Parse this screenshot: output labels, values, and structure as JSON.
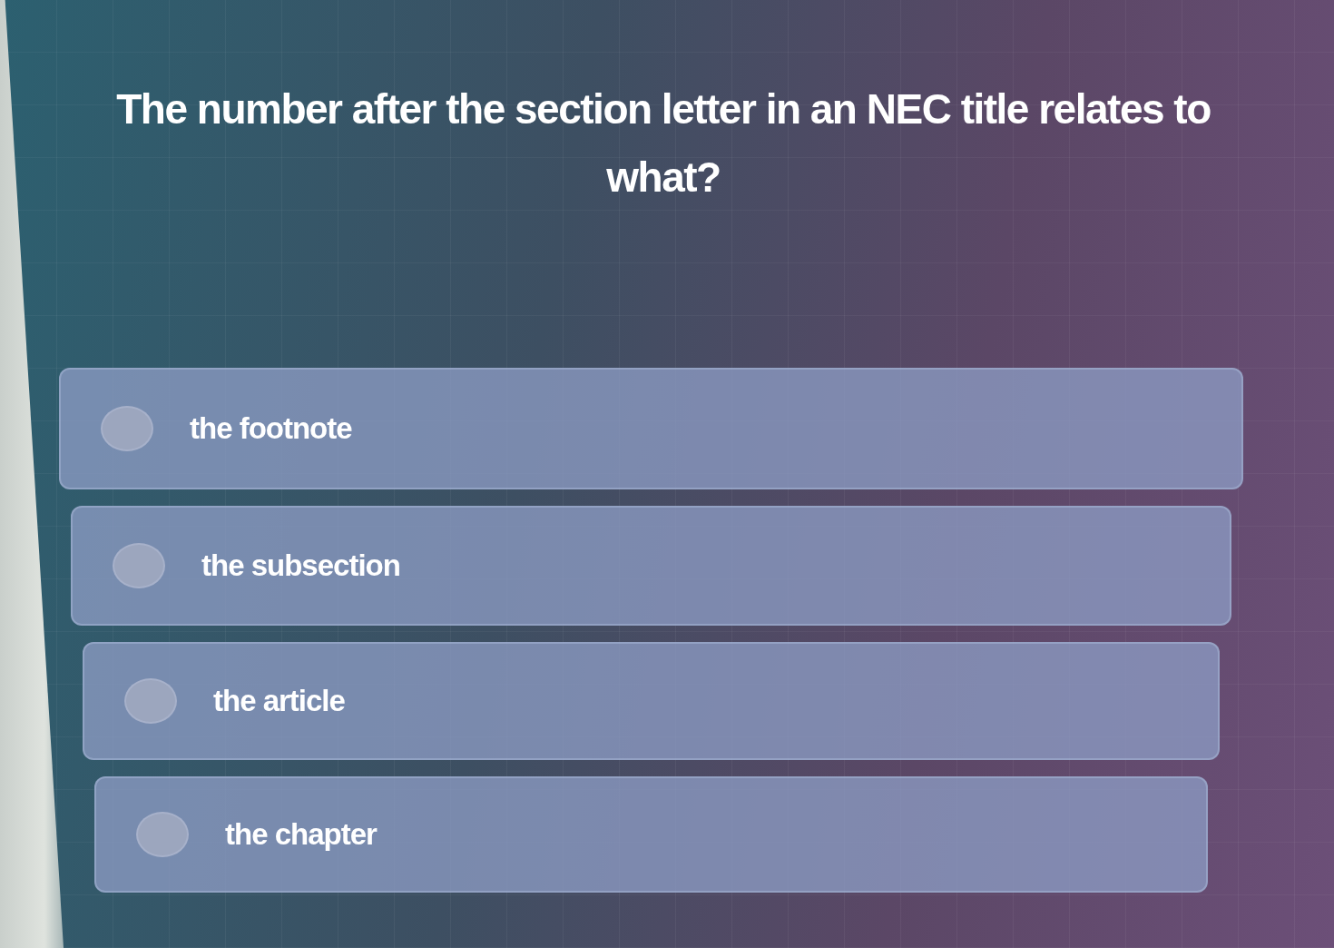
{
  "question": "The number after the section letter in an NEC title relates to what?",
  "options": [
    {
      "label": "the footnote",
      "selected": false
    },
    {
      "label": "the subsection",
      "selected": false
    },
    {
      "label": "the article",
      "selected": false
    },
    {
      "label": "the chapter",
      "selected": false
    }
  ]
}
